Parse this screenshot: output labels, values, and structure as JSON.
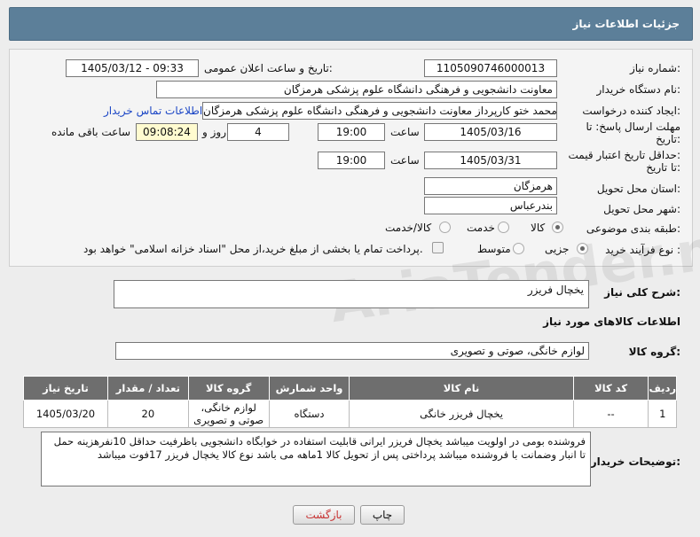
{
  "header": {
    "title": "جزئیات اطلاعات نیاز"
  },
  "fields": {
    "need_number_label": "شماره نیاز:",
    "need_number": "1105090746000013",
    "announce_label": "تاریخ و ساعت اعلان عمومی:",
    "announce_value": "1405/03/12 - 09:33",
    "buyer_label": "نام دستگاه خریدار:",
    "buyer_value": "معاونت دانشجویی و فرهنگی دانشگاه علوم پزشکی هرمزگان",
    "creator_label": "ایجاد کننده درخواست:",
    "creator_value": "محمد ختو کارپرداز معاونت دانشجویی و فرهنگی دانشگاه علوم پزشکی هرمزگان",
    "contact_link": "اطلاعات تماس خریدار",
    "deadline_label_1": "مهلت ارسال پاسخ: تا",
    "deadline_label_2": "تاریخ:",
    "deadline_date": "1405/03/16",
    "time_label": "ساعت",
    "deadline_time": "19:00",
    "days_value": "4",
    "days_label": "روز و",
    "remaining_time": "09:08:24",
    "remaining_label": "ساعت باقی مانده",
    "validity_label_1": "حداقل تاریخ اعتبار قیمت:",
    "validity_label_2": "تا تاریخ:",
    "validity_date": "1405/03/31",
    "validity_time": "19:00",
    "province_label": "استان محل تحویل:",
    "province_value": "هرمزگان",
    "city_label": "شهر محل تحویل:",
    "city_value": "بندرعباس",
    "category_label": "طبقه بندی موضوعی:",
    "category_options": [
      "کالا",
      "خدمت",
      "کالا/خدمت"
    ],
    "process_label": "نوع فرآیند خرید :",
    "process_options": [
      "جزیی",
      "متوسط"
    ],
    "payment_text": "پرداخت تمام یا بخشی از مبلغ خرید،از محل \"اسناد خزانه اسلامی\" خواهد بود."
  },
  "summary": {
    "label": "شرح کلی نیاز:",
    "value": "یخچال فریزر"
  },
  "goods_section_title": "اطلاعات کالاهای مورد نیاز",
  "goods_group": {
    "label": "گروه کالا:",
    "value": "لوازم خانگی، صوتی و تصویری"
  },
  "table": {
    "headers": [
      "ردیف",
      "کد کالا",
      "نام کالا",
      "واحد شمارش",
      "گروه کالا",
      "تعداد / مقدار",
      "تاریخ نیاز"
    ],
    "rows": [
      [
        "1",
        "--",
        "یخچال فریزر خانگی",
        "دستگاه",
        "لوازم خانگی، صوتی و تصویری",
        "20",
        "1405/03/20"
      ]
    ]
  },
  "notes": {
    "label": "توضیحات خریدار:",
    "value": "فروشنده بومی در اولویت میباشد یخچال فریزر ایرانی قابلیت استفاده در خوابگاه دانشجویی باظرفیت حداقل 10نفرهزینه حمل تا انبار وضمانت با فروشنده میباشد پرداختی پس از تحویل کالا 1ماهه می باشد نوع کالا یخچال فریزر 17فوت میباشد"
  },
  "buttons": {
    "print": "چاپ",
    "back": "بازگشت"
  },
  "watermark": "AriaTender.net",
  "colors": {
    "header_bg": "#5c7f99",
    "table_header": "#6e6e6e",
    "link": "#1a45c5",
    "back_text": "#c83232"
  }
}
